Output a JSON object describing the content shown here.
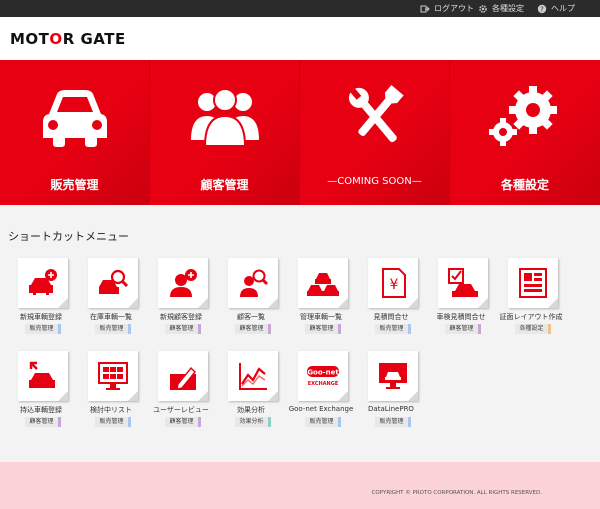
{
  "topbar": {
    "logout": "ログアウト",
    "settings": "各種設定",
    "help": "ヘルプ"
  },
  "logo": {
    "pre": "MOT",
    "o": "O",
    "post": "R GATE"
  },
  "banner": [
    {
      "label": "販売管理",
      "icon": "car-icon"
    },
    {
      "label": "顧客管理",
      "icon": "people-icon"
    },
    {
      "label": "—COMING SOON—",
      "icon": "tools-icon"
    },
    {
      "label": "各種設定",
      "icon": "gears-icon"
    }
  ],
  "shortcut_title": "ショートカットメニュー",
  "shortcuts": [
    {
      "name": "新規車輌登録",
      "tag": "販売管理",
      "icon": "car-plus-icon"
    },
    {
      "name": "在庫車輌一覧",
      "tag": "販売管理",
      "icon": "car-search-icon"
    },
    {
      "name": "新規顧客登録",
      "tag": "顧客管理",
      "icon": "person-plus-icon"
    },
    {
      "name": "顧客一覧",
      "tag": "顧客管理",
      "icon": "person-search-icon"
    },
    {
      "name": "管理車輌一覧",
      "tag": "顧客管理",
      "icon": "cars-icon"
    },
    {
      "name": "見積問合せ",
      "tag": "販売管理",
      "icon": "yen-doc-icon"
    },
    {
      "name": "車検見積問合せ",
      "tag": "顧客管理",
      "icon": "car-check-icon"
    },
    {
      "name": "証面レイアウト作成",
      "tag": "各種設定",
      "icon": "layout-icon"
    },
    {
      "name": "持込車輌登録",
      "tag": "顧客管理",
      "icon": "car-in-icon"
    },
    {
      "name": "検討中リスト",
      "tag": "販売管理",
      "icon": "monitor-cars-icon"
    },
    {
      "name": "ユーザーレビュー",
      "tag": "顧客管理",
      "icon": "review-icon"
    },
    {
      "name": "効果分析",
      "tag": "効果分析",
      "icon": "chart-icon"
    },
    {
      "name": "Goo-net Exchange",
      "tag": "販売管理",
      "icon": "goonet-icon",
      "logo_top": "Goo-net",
      "logo_bottom": "EXCHANGE"
    },
    {
      "name": "DataLinePRO",
      "tag": "販売管理",
      "icon": "monitor-car-icon"
    }
  ],
  "footer": {
    "copyright": "COPYRIGHT © PROTO CORPORATION. ALL RIGHTS RESERVED."
  },
  "colors": {
    "brand": "#e60012",
    "footer": "#fbd2d6",
    "topbar": "#2b2b2b"
  }
}
